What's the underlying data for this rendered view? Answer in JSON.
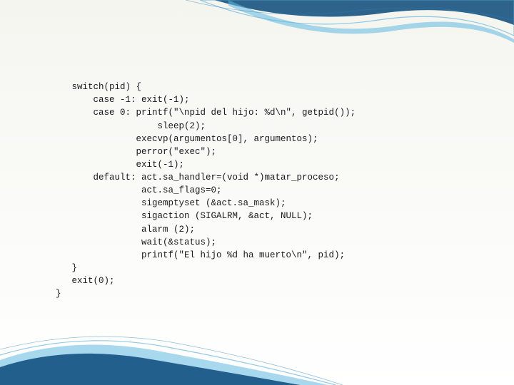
{
  "code": {
    "l1": "   switch(pid) {",
    "l2": "       case -1: exit(-1);",
    "l3": "       case 0: printf(\"\\npid del hijo: %d\\n\", getpid());",
    "l4": "                   sleep(2);",
    "l5": "               execvp(argumentos[0], argumentos);",
    "l6": "               perror(\"exec\");",
    "l7": "               exit(-1);",
    "l8": "       default: act.sa_handler=(void *)matar_proceso;",
    "l9": "                act.sa_flags=0;",
    "l10": "                sigemptyset (&act.sa_mask);",
    "l11": "                sigaction (SIGALRM, &act, NULL);",
    "l12": "                alarm (2);",
    "l13": "                wait(&status);",
    "l14": "                printf(\"El hijo %d ha muerto\\n\", pid);",
    "l15": "   }",
    "l16": "   exit(0);",
    "l17": "}"
  }
}
